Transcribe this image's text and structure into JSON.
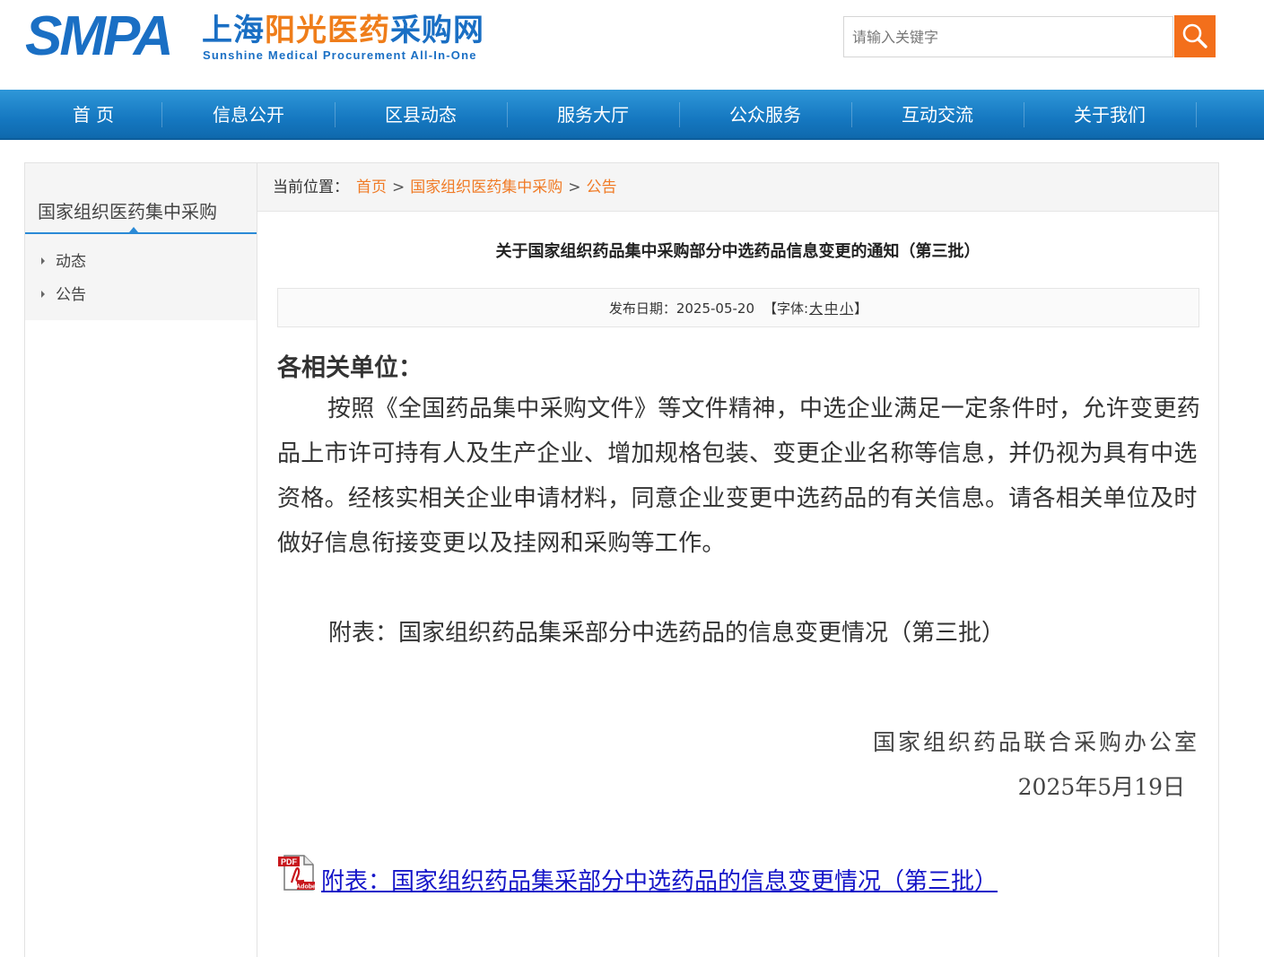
{
  "header": {
    "logo": {
      "smpa": "SMPA",
      "cn_part1": "上海",
      "cn_part2": "阳光医药",
      "cn_part3": "采购网",
      "en": "Sunshine Medical Procurement All-In-One"
    },
    "search": {
      "placeholder": "请输入关键字",
      "button_icon": "search-icon"
    }
  },
  "nav": {
    "items": [
      {
        "label": "首 页"
      },
      {
        "label": "信息公开"
      },
      {
        "label": "区县动态"
      },
      {
        "label": "服务大厅"
      },
      {
        "label": "公众服务"
      },
      {
        "label": "互动交流"
      },
      {
        "label": "关于我们"
      }
    ]
  },
  "sidebar": {
    "title": "国家组织医药集中采购",
    "items": [
      {
        "label": "动态"
      },
      {
        "label": "公告"
      }
    ]
  },
  "breadcrumb": {
    "prefix": "当前位置：",
    "items": [
      {
        "label": "首页"
      },
      {
        "label": "国家组织医药集中采购"
      },
      {
        "label": "公告"
      }
    ],
    "separator": ">"
  },
  "article": {
    "title": "关于国家组织药品集中采购部分中选药品信息变更的通知（第三批）",
    "meta": {
      "date_label": "发布日期：2025-05-20",
      "font_open": "【字体:",
      "font_large": "大",
      "font_medium": "中",
      "font_small": "小",
      "font_close": "】"
    },
    "greeting": "各相关单位：",
    "paragraph": "按照《全国药品集中采购文件》等文件精神，中选企业满足一定条件时，允许变更药品上市许可持有人及生产企业、增加规格包装、变更企业名称等信息，并仍视为具有中选资格。经核实相关企业申请材料，同意企业变更中选药品的有关信息。请各相关单位及时做好信息衔接变更以及挂网和采购等工作。",
    "attachment_note": "附表：国家组织药品集采部分中选药品的信息变更情况（第三批）",
    "signature_org": "国家组织药品联合采购办公室",
    "signature_date": "2025年5月19日",
    "attachment": {
      "icon": "pdf-icon",
      "pdf_badge": "PDF",
      "adobe_badge": "Adobe",
      "link": "附表：国家组织药品集采部分中选药品的信息变更情况（第三批）"
    }
  },
  "colors": {
    "brand_blue": "#1a6fc4",
    "brand_orange": "#ef7d1a",
    "nav_blue": "#1578c1",
    "search_orange": "#f36f1b",
    "link_blue": "#1515c8",
    "crumb_orange": "#f07b26"
  }
}
